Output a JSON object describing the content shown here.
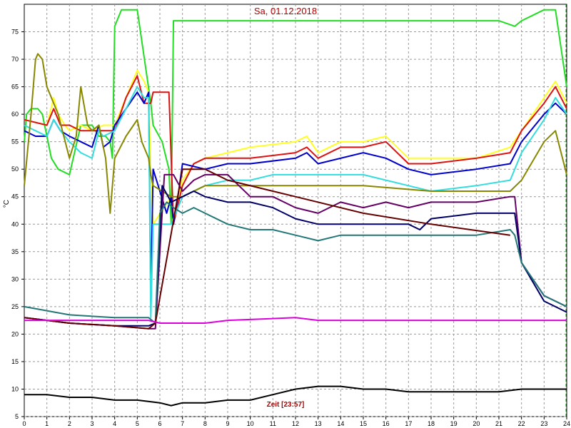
{
  "chart_data": {
    "type": "line",
    "title": "Sa, 01.12.2018",
    "xlabel": "Zeit [23:57]",
    "ylabel": "°C",
    "xlim": [
      0,
      24
    ],
    "ylim": [
      5,
      80
    ],
    "xticks": [
      0,
      1,
      2,
      3,
      4,
      5,
      6,
      7,
      8,
      9,
      10,
      11,
      12,
      13,
      14,
      15,
      16,
      17,
      18,
      19,
      20,
      21,
      22,
      23,
      24
    ],
    "yticks": [
      5,
      10,
      15,
      20,
      25,
      30,
      35,
      40,
      45,
      50,
      55,
      60,
      65,
      70,
      75
    ],
    "grid": true,
    "series": [
      {
        "color": "#22dd22",
        "x": [
          0,
          0.1,
          0.3,
          0.6,
          0.8,
          1.0,
          1.2,
          1.5,
          2.0,
          2.5,
          3.0,
          3.3,
          3.6,
          3.8,
          3.9,
          4.0,
          4.3,
          4.6,
          5.0,
          5.6,
          5.7,
          6.1,
          6.4,
          6.5,
          6.6,
          6.8,
          7,
          9,
          12,
          15,
          18,
          21,
          21.7,
          22,
          23,
          23.5,
          24
        ],
        "y": [
          55,
          60,
          61,
          61,
          60,
          56,
          52,
          50,
          49,
          58,
          58,
          56,
          56,
          55,
          52,
          76,
          79,
          79,
          79,
          62,
          58,
          55,
          50,
          40,
          77,
          77,
          77,
          77,
          77,
          77,
          77,
          77,
          76,
          77,
          79,
          79,
          65
        ]
      },
      {
        "color": "#ffff22",
        "x": [
          0,
          1.0,
          1.3,
          1.5,
          1.8,
          2.0,
          2.5,
          3.0,
          3.5,
          4.0,
          4.5,
          5.0,
          5.3,
          5.5,
          5.6,
          5.7,
          6.5,
          6.6,
          7,
          7.5,
          8,
          9,
          10,
          12,
          12.5,
          13,
          14,
          15,
          16,
          17,
          18,
          20,
          21.5,
          22,
          23,
          23.5,
          24
        ],
        "y": [
          59,
          58,
          63,
          60,
          58,
          57,
          58,
          57,
          58,
          58,
          63,
          68,
          66,
          64,
          49,
          40,
          45,
          40,
          48,
          51,
          52,
          53,
          54,
          55,
          56,
          53,
          55,
          55,
          56,
          52,
          52,
          52,
          54,
          57,
          63,
          66,
          62
        ]
      },
      {
        "color": "#dd1111",
        "x": [
          0,
          1.0,
          1.3,
          1.6,
          2.0,
          2.5,
          3.0,
          3.5,
          4.0,
          4.5,
          5.0,
          5.3,
          5.6,
          5.7,
          6.0,
          6.4,
          6.6,
          7,
          7.5,
          8,
          9,
          10,
          12,
          12.5,
          13,
          14,
          15,
          16,
          17,
          18,
          20,
          21.5,
          22,
          23,
          23.5,
          24
        ],
        "y": [
          59,
          58,
          61,
          58,
          58,
          57,
          57,
          57,
          57,
          63,
          67,
          62,
          62,
          64,
          64,
          64,
          40,
          47,
          51,
          52,
          52,
          52,
          53,
          54,
          52,
          54,
          54,
          55,
          51,
          51,
          52,
          53,
          57,
          62,
          65,
          61
        ]
      },
      {
        "color": "#0000cc",
        "x": [
          0,
          0.5,
          1.0,
          1.3,
          1.6,
          2.0,
          2.5,
          3.0,
          3.3,
          3.5,
          3.8,
          4.0,
          4.5,
          5.0,
          5.3,
          5.5,
          5.6,
          5.7,
          6.3,
          6.5,
          6.6,
          6.8,
          7,
          8,
          9,
          10,
          12,
          12.5,
          13,
          15,
          16,
          17,
          18,
          20,
          21.5,
          22,
          23,
          23.5,
          24
        ],
        "y": [
          57,
          56,
          56,
          59,
          57,
          56,
          55,
          54,
          58,
          54,
          55,
          58,
          61,
          64,
          62,
          64,
          26,
          50,
          42,
          45,
          40,
          45,
          51,
          50,
          51,
          51,
          52,
          53,
          51,
          53,
          52,
          50,
          49,
          50,
          51,
          55,
          60,
          62,
          60
        ]
      },
      {
        "color": "#33dddd",
        "x": [
          0,
          0.5,
          1.0,
          1.3,
          1.6,
          2.0,
          2.5,
          3.0,
          3.3,
          3.5,
          4.0,
          4.5,
          5.0,
          5.3,
          5.5,
          5.6,
          5.7,
          6.5,
          7,
          8,
          9,
          10,
          11,
          12,
          13,
          14,
          15,
          16,
          17,
          18,
          20,
          21.5,
          22,
          23,
          23.5,
          24
        ],
        "y": [
          58,
          57,
          56,
          59,
          57,
          55,
          53,
          52,
          57,
          56,
          57,
          61,
          65,
          63,
          63,
          23,
          40,
          40,
          45,
          47,
          48,
          48,
          49,
          49,
          49,
          49,
          49,
          48,
          47,
          46,
          47,
          48,
          53,
          59,
          63,
          60
        ]
      },
      {
        "color": "#888800",
        "x": [
          0,
          0.3,
          0.5,
          0.6,
          0.8,
          1.0,
          1.5,
          2.0,
          2.3,
          2.5,
          2.8,
          3.0,
          3.3,
          3.6,
          3.8,
          4.0,
          4.5,
          5.0,
          5.2,
          5.5,
          5.6,
          5.7,
          6.5,
          7,
          8,
          9,
          10,
          12,
          15,
          18,
          20,
          21.5,
          22,
          23,
          23.5,
          24
        ],
        "y": [
          47,
          60,
          70,
          71,
          70,
          65,
          60,
          52,
          56,
          65,
          58,
          57,
          58,
          52,
          42,
          52,
          56,
          59,
          55,
          52,
          49,
          47,
          45,
          45,
          47,
          47,
          47,
          47,
          47,
          46,
          46,
          46,
          48,
          55,
          57,
          49
        ]
      },
      {
        "color": "#660066",
        "x": [
          0,
          2,
          4,
          5.5,
          5.8,
          6.2,
          6.6,
          7,
          7.5,
          8,
          9,
          9.5,
          10,
          11,
          12,
          13,
          14,
          15,
          16,
          17,
          18,
          20,
          21.5,
          21.7,
          22,
          23,
          24
        ],
        "y": [
          23,
          22,
          21.5,
          21,
          21,
          49,
          49,
          46,
          48,
          49,
          49,
          47,
          45,
          45,
          43,
          42,
          44,
          43,
          44,
          43,
          44,
          44,
          45,
          45,
          33,
          27,
          25
        ]
      },
      {
        "color": "#000066",
        "x": [
          0,
          2,
          4,
          5.5,
          5.8,
          6.1,
          6.5,
          7,
          7.5,
          8,
          9,
          10,
          11,
          12,
          13,
          14,
          15,
          16,
          17,
          17.5,
          18,
          20,
          21.5,
          21.7,
          22,
          23,
          24
        ],
        "y": [
          23,
          22,
          21.5,
          21.5,
          22,
          47,
          44,
          45,
          46,
          45,
          44,
          44,
          43,
          41,
          40,
          40,
          40,
          40,
          40,
          39,
          41,
          42,
          42,
          42,
          33,
          26,
          24
        ]
      },
      {
        "color": "#227777",
        "x": [
          0,
          2,
          4,
          5.5,
          5.8,
          6.0,
          6.3,
          6.6,
          7,
          7.5,
          8,
          9,
          10,
          11,
          12,
          13,
          14,
          15,
          16,
          17,
          18,
          20,
          21.5,
          21.7,
          22,
          23,
          24
        ],
        "y": [
          25,
          23.5,
          23,
          23,
          22,
          42,
          44,
          43,
          42,
          43,
          42,
          40,
          39,
          39,
          38,
          37,
          38,
          38,
          38,
          38,
          38,
          38,
          39,
          38,
          33,
          27,
          25
        ]
      },
      {
        "color": "#660000",
        "x": [
          0,
          2,
          4,
          5.5,
          5.8,
          7,
          8,
          9,
          12,
          15,
          18,
          21.5
        ],
        "y": [
          23,
          22,
          21.5,
          21,
          22,
          50,
          50,
          48,
          45,
          42,
          40,
          38
        ]
      },
      {
        "color": "#dd00dd",
        "x": [
          0,
          2,
          4,
          5.5,
          6,
          8,
          9,
          12,
          13,
          15,
          18,
          21,
          24
        ],
        "y": [
          22.5,
          22.5,
          22.5,
          22.5,
          22,
          22,
          22.5,
          23,
          22.5,
          22.5,
          22.5,
          22.5,
          22.5
        ]
      },
      {
        "color": "#000000",
        "x": [
          0,
          1,
          2,
          3,
          4,
          5,
          6,
          6.5,
          7,
          8,
          9,
          10,
          11,
          12,
          13,
          14,
          15,
          16,
          17,
          18,
          19,
          20,
          21,
          22,
          23,
          24
        ],
        "y": [
          9,
          9,
          8.5,
          8.5,
          8,
          8,
          7.5,
          7,
          7.5,
          7.5,
          8,
          8,
          9,
          10,
          10.5,
          10.5,
          10,
          10,
          9.5,
          9.5,
          9.5,
          9.5,
          9.5,
          10,
          10,
          10
        ]
      }
    ]
  }
}
